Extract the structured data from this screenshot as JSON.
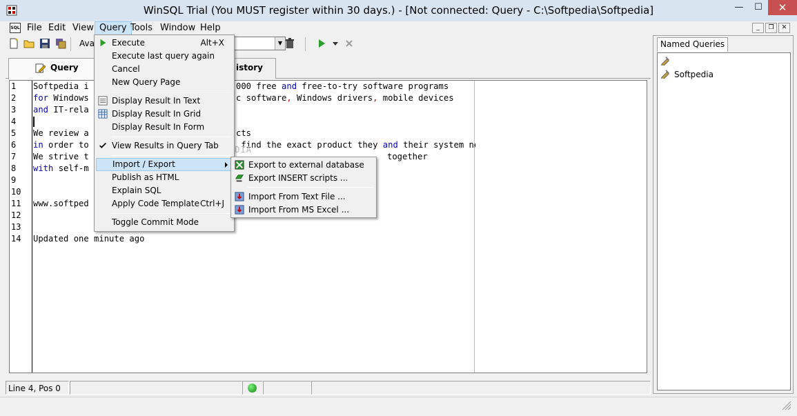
{
  "window": {
    "title": "WinSQL Trial (You MUST register within 30 days.) - [Not connected: Query - C:\\Softpedia\\Softpedia]",
    "minimize": "—",
    "maximize": "☐",
    "close": "✕"
  },
  "menubar": {
    "doc_icon_text": "SQL",
    "items": [
      "File",
      "Edit",
      "View",
      "Query",
      "Tools",
      "Window",
      "Help"
    ],
    "active": "Query",
    "mdi_buttons": [
      "_",
      "❐",
      "✕"
    ]
  },
  "toolbar": {
    "label": "Avai"
  },
  "tabs": {
    "query": "Query",
    "history": "istory"
  },
  "editor": {
    "line_numbers": [
      "1",
      "2",
      "3",
      "4",
      "5",
      "6",
      "7",
      "8",
      "9",
      "10",
      "11",
      "12",
      "13",
      "14"
    ],
    "lines": [
      "Softpedia i",
      "for Windows",
      "and IT-rela",
      "",
      "We review a",
      "in order to",
      "We strive t",
      "with self-m",
      "",
      "",
      "www.softped",
      "",
      "",
      "Updated one minute ago"
    ],
    "tails": {
      "l1_a": "000 free ",
      "l1_kw": "and",
      "l1_b": " free-to-try software programs",
      "l2_a": "c software",
      "l2_r1": ",",
      "l2_b": " Windows drivers",
      "l2_r2": ",",
      "l2_c": " mobile devices",
      "l5": "cts",
      "l6_a": " find the exact product they ",
      "l6_kw": "and",
      "l6_b": " their system needs.",
      "l7": "together"
    },
    "watermark": "SOFTPEDIA"
  },
  "status": {
    "position": "Line 4, Pos 0",
    "connection_color": "#14a014"
  },
  "side_panel": {
    "tab": "Named Queries",
    "items": [
      "Softpedia"
    ]
  },
  "query_menu": {
    "execute": "Execute",
    "execute_shortcut": "Alt+X",
    "execute_last": "Execute last query again",
    "cancel": "Cancel",
    "new_page": "New Query Page",
    "display_text": "Display Result In Text",
    "display_grid": "Display Result In Grid",
    "display_form": "Display Result In Form",
    "view_in_tab": "View Results in Query Tab",
    "import_export": "Import / Export",
    "publish_html": "Publish as HTML",
    "explain_sql": "Explain SQL",
    "apply_template": "Apply Code Template",
    "apply_template_shortcut": "Ctrl+J",
    "toggle_commit": "Toggle Commit Mode"
  },
  "import_export_menu": {
    "export_external": "Export to external database ...",
    "export_insert": "Export INSERT scripts ...",
    "import_text": "Import From Text File ...",
    "import_excel": "Import From MS Excel ..."
  },
  "colors": {
    "keyword": "#0000c0",
    "punctuation": "#c00000",
    "highlight": "#cce4f7",
    "close_button": "#c75050"
  }
}
